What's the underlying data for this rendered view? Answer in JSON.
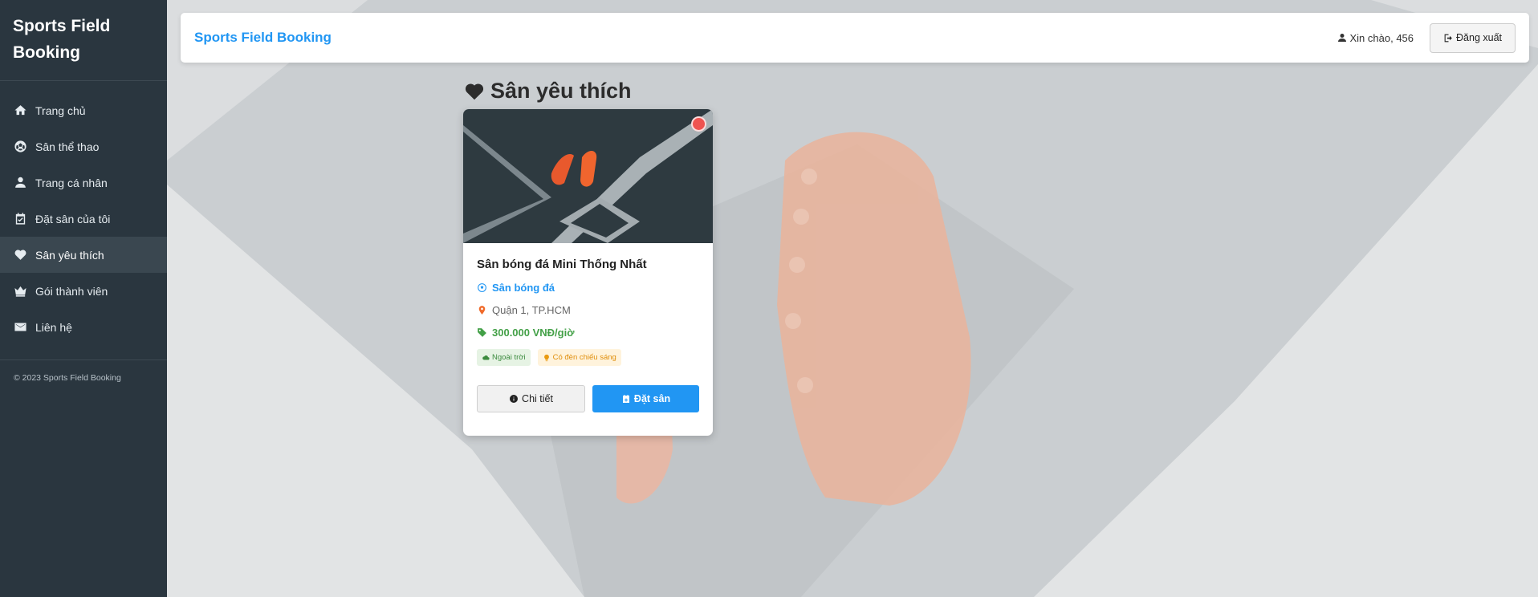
{
  "sidebar": {
    "brand": "Sports Field Booking",
    "items": [
      {
        "label": "Trang chủ",
        "icon": "home-icon"
      },
      {
        "label": "Sân thể thao",
        "icon": "soccer-ball-icon"
      },
      {
        "label": "Trang cá nhân",
        "icon": "user-icon"
      },
      {
        "label": "Đặt sân của tôi",
        "icon": "calendar-check-icon"
      },
      {
        "label": "Sân yêu thích",
        "icon": "heart-icon",
        "active": true
      },
      {
        "label": "Gói thành viên",
        "icon": "crown-icon"
      },
      {
        "label": "Liên hệ",
        "icon": "envelope-icon"
      }
    ],
    "footer": "© 2023 Sports Field Booking"
  },
  "header": {
    "title": "Sports Field Booking",
    "greeting": "Xin chào, 456",
    "logout_label": "Đăng xuất"
  },
  "page": {
    "title": "Sân yêu thích"
  },
  "favorites": [
    {
      "name": "Sân bóng đá Mini Thống Nhất",
      "type": "Sân bóng đá",
      "location": "Quận 1, TP.HCM",
      "price": "300.000 VNĐ/giờ",
      "tags": [
        "Ngoài trời",
        "Có đèn chiếu sáng"
      ],
      "detail_label": "Chi tiết",
      "book_label": "Đặt sân"
    }
  ],
  "colors": {
    "sidebar_bg": "#2a363f",
    "accent": "#2196f3",
    "price": "#43a047",
    "favorite": "#ef5350"
  }
}
